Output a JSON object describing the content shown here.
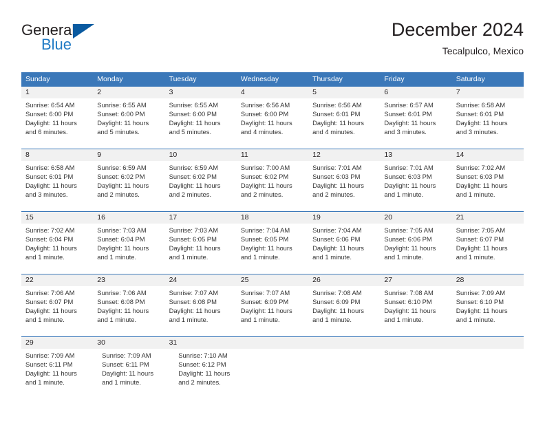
{
  "brand": {
    "name_part1": "General",
    "name_part2": "Blue",
    "logo_icon": "blue-triangle-icon"
  },
  "header": {
    "title": "December 2024",
    "location": "Tecalpulco, Mexico"
  },
  "colors": {
    "header_bar": "#3b78b9",
    "daynum_band": "#f1f1f1",
    "brand_blue": "#1f7ac4",
    "triangle_blue": "#0a5aa0",
    "text": "#231f20",
    "cell_text": "#333333"
  },
  "weekdays": [
    "Sunday",
    "Monday",
    "Tuesday",
    "Wednesday",
    "Thursday",
    "Friday",
    "Saturday"
  ],
  "weeks": [
    {
      "days": [
        {
          "num": "1",
          "sunrise": "Sunrise: 6:54 AM",
          "sunset": "Sunset: 6:00 PM",
          "daylight1": "Daylight: 11 hours",
          "daylight2": "and 6 minutes."
        },
        {
          "num": "2",
          "sunrise": "Sunrise: 6:55 AM",
          "sunset": "Sunset: 6:00 PM",
          "daylight1": "Daylight: 11 hours",
          "daylight2": "and 5 minutes."
        },
        {
          "num": "3",
          "sunrise": "Sunrise: 6:55 AM",
          "sunset": "Sunset: 6:00 PM",
          "daylight1": "Daylight: 11 hours",
          "daylight2": "and 5 minutes."
        },
        {
          "num": "4",
          "sunrise": "Sunrise: 6:56 AM",
          "sunset": "Sunset: 6:00 PM",
          "daylight1": "Daylight: 11 hours",
          "daylight2": "and 4 minutes."
        },
        {
          "num": "5",
          "sunrise": "Sunrise: 6:56 AM",
          "sunset": "Sunset: 6:01 PM",
          "daylight1": "Daylight: 11 hours",
          "daylight2": "and 4 minutes."
        },
        {
          "num": "6",
          "sunrise": "Sunrise: 6:57 AM",
          "sunset": "Sunset: 6:01 PM",
          "daylight1": "Daylight: 11 hours",
          "daylight2": "and 3 minutes."
        },
        {
          "num": "7",
          "sunrise": "Sunrise: 6:58 AM",
          "sunset": "Sunset: 6:01 PM",
          "daylight1": "Daylight: 11 hours",
          "daylight2": "and 3 minutes."
        }
      ]
    },
    {
      "days": [
        {
          "num": "8",
          "sunrise": "Sunrise: 6:58 AM",
          "sunset": "Sunset: 6:01 PM",
          "daylight1": "Daylight: 11 hours",
          "daylight2": "and 3 minutes."
        },
        {
          "num": "9",
          "sunrise": "Sunrise: 6:59 AM",
          "sunset": "Sunset: 6:02 PM",
          "daylight1": "Daylight: 11 hours",
          "daylight2": "and 2 minutes."
        },
        {
          "num": "10",
          "sunrise": "Sunrise: 6:59 AM",
          "sunset": "Sunset: 6:02 PM",
          "daylight1": "Daylight: 11 hours",
          "daylight2": "and 2 minutes."
        },
        {
          "num": "11",
          "sunrise": "Sunrise: 7:00 AM",
          "sunset": "Sunset: 6:02 PM",
          "daylight1": "Daylight: 11 hours",
          "daylight2": "and 2 minutes."
        },
        {
          "num": "12",
          "sunrise": "Sunrise: 7:01 AM",
          "sunset": "Sunset: 6:03 PM",
          "daylight1": "Daylight: 11 hours",
          "daylight2": "and 2 minutes."
        },
        {
          "num": "13",
          "sunrise": "Sunrise: 7:01 AM",
          "sunset": "Sunset: 6:03 PM",
          "daylight1": "Daylight: 11 hours",
          "daylight2": "and 1 minute."
        },
        {
          "num": "14",
          "sunrise": "Sunrise: 7:02 AM",
          "sunset": "Sunset: 6:03 PM",
          "daylight1": "Daylight: 11 hours",
          "daylight2": "and 1 minute."
        }
      ]
    },
    {
      "days": [
        {
          "num": "15",
          "sunrise": "Sunrise: 7:02 AM",
          "sunset": "Sunset: 6:04 PM",
          "daylight1": "Daylight: 11 hours",
          "daylight2": "and 1 minute."
        },
        {
          "num": "16",
          "sunrise": "Sunrise: 7:03 AM",
          "sunset": "Sunset: 6:04 PM",
          "daylight1": "Daylight: 11 hours",
          "daylight2": "and 1 minute."
        },
        {
          "num": "17",
          "sunrise": "Sunrise: 7:03 AM",
          "sunset": "Sunset: 6:05 PM",
          "daylight1": "Daylight: 11 hours",
          "daylight2": "and 1 minute."
        },
        {
          "num": "18",
          "sunrise": "Sunrise: 7:04 AM",
          "sunset": "Sunset: 6:05 PM",
          "daylight1": "Daylight: 11 hours",
          "daylight2": "and 1 minute."
        },
        {
          "num": "19",
          "sunrise": "Sunrise: 7:04 AM",
          "sunset": "Sunset: 6:06 PM",
          "daylight1": "Daylight: 11 hours",
          "daylight2": "and 1 minute."
        },
        {
          "num": "20",
          "sunrise": "Sunrise: 7:05 AM",
          "sunset": "Sunset: 6:06 PM",
          "daylight1": "Daylight: 11 hours",
          "daylight2": "and 1 minute."
        },
        {
          "num": "21",
          "sunrise": "Sunrise: 7:05 AM",
          "sunset": "Sunset: 6:07 PM",
          "daylight1": "Daylight: 11 hours",
          "daylight2": "and 1 minute."
        }
      ]
    },
    {
      "days": [
        {
          "num": "22",
          "sunrise": "Sunrise: 7:06 AM",
          "sunset": "Sunset: 6:07 PM",
          "daylight1": "Daylight: 11 hours",
          "daylight2": "and 1 minute."
        },
        {
          "num": "23",
          "sunrise": "Sunrise: 7:06 AM",
          "sunset": "Sunset: 6:08 PM",
          "daylight1": "Daylight: 11 hours",
          "daylight2": "and 1 minute."
        },
        {
          "num": "24",
          "sunrise": "Sunrise: 7:07 AM",
          "sunset": "Sunset: 6:08 PM",
          "daylight1": "Daylight: 11 hours",
          "daylight2": "and 1 minute."
        },
        {
          "num": "25",
          "sunrise": "Sunrise: 7:07 AM",
          "sunset": "Sunset: 6:09 PM",
          "daylight1": "Daylight: 11 hours",
          "daylight2": "and 1 minute."
        },
        {
          "num": "26",
          "sunrise": "Sunrise: 7:08 AM",
          "sunset": "Sunset: 6:09 PM",
          "daylight1": "Daylight: 11 hours",
          "daylight2": "and 1 minute."
        },
        {
          "num": "27",
          "sunrise": "Sunrise: 7:08 AM",
          "sunset": "Sunset: 6:10 PM",
          "daylight1": "Daylight: 11 hours",
          "daylight2": "and 1 minute."
        },
        {
          "num": "28",
          "sunrise": "Sunrise: 7:09 AM",
          "sunset": "Sunset: 6:10 PM",
          "daylight1": "Daylight: 11 hours",
          "daylight2": "and 1 minute."
        }
      ]
    },
    {
      "days": [
        {
          "num": "29",
          "sunrise": "Sunrise: 7:09 AM",
          "sunset": "Sunset: 6:11 PM",
          "daylight1": "Daylight: 11 hours",
          "daylight2": "and 1 minute."
        },
        {
          "num": "30",
          "sunrise": "Sunrise: 7:09 AM",
          "sunset": "Sunset: 6:11 PM",
          "daylight1": "Daylight: 11 hours",
          "daylight2": "and 1 minute."
        },
        {
          "num": "31",
          "sunrise": "Sunrise: 7:10 AM",
          "sunset": "Sunset: 6:12 PM",
          "daylight1": "Daylight: 11 hours",
          "daylight2": "and 2 minutes."
        },
        {
          "num": "",
          "sunrise": "",
          "sunset": "",
          "daylight1": "",
          "daylight2": ""
        },
        {
          "num": "",
          "sunrise": "",
          "sunset": "",
          "daylight1": "",
          "daylight2": ""
        },
        {
          "num": "",
          "sunrise": "",
          "sunset": "",
          "daylight1": "",
          "daylight2": ""
        },
        {
          "num": "",
          "sunrise": "",
          "sunset": "",
          "daylight1": "",
          "daylight2": ""
        }
      ]
    }
  ]
}
